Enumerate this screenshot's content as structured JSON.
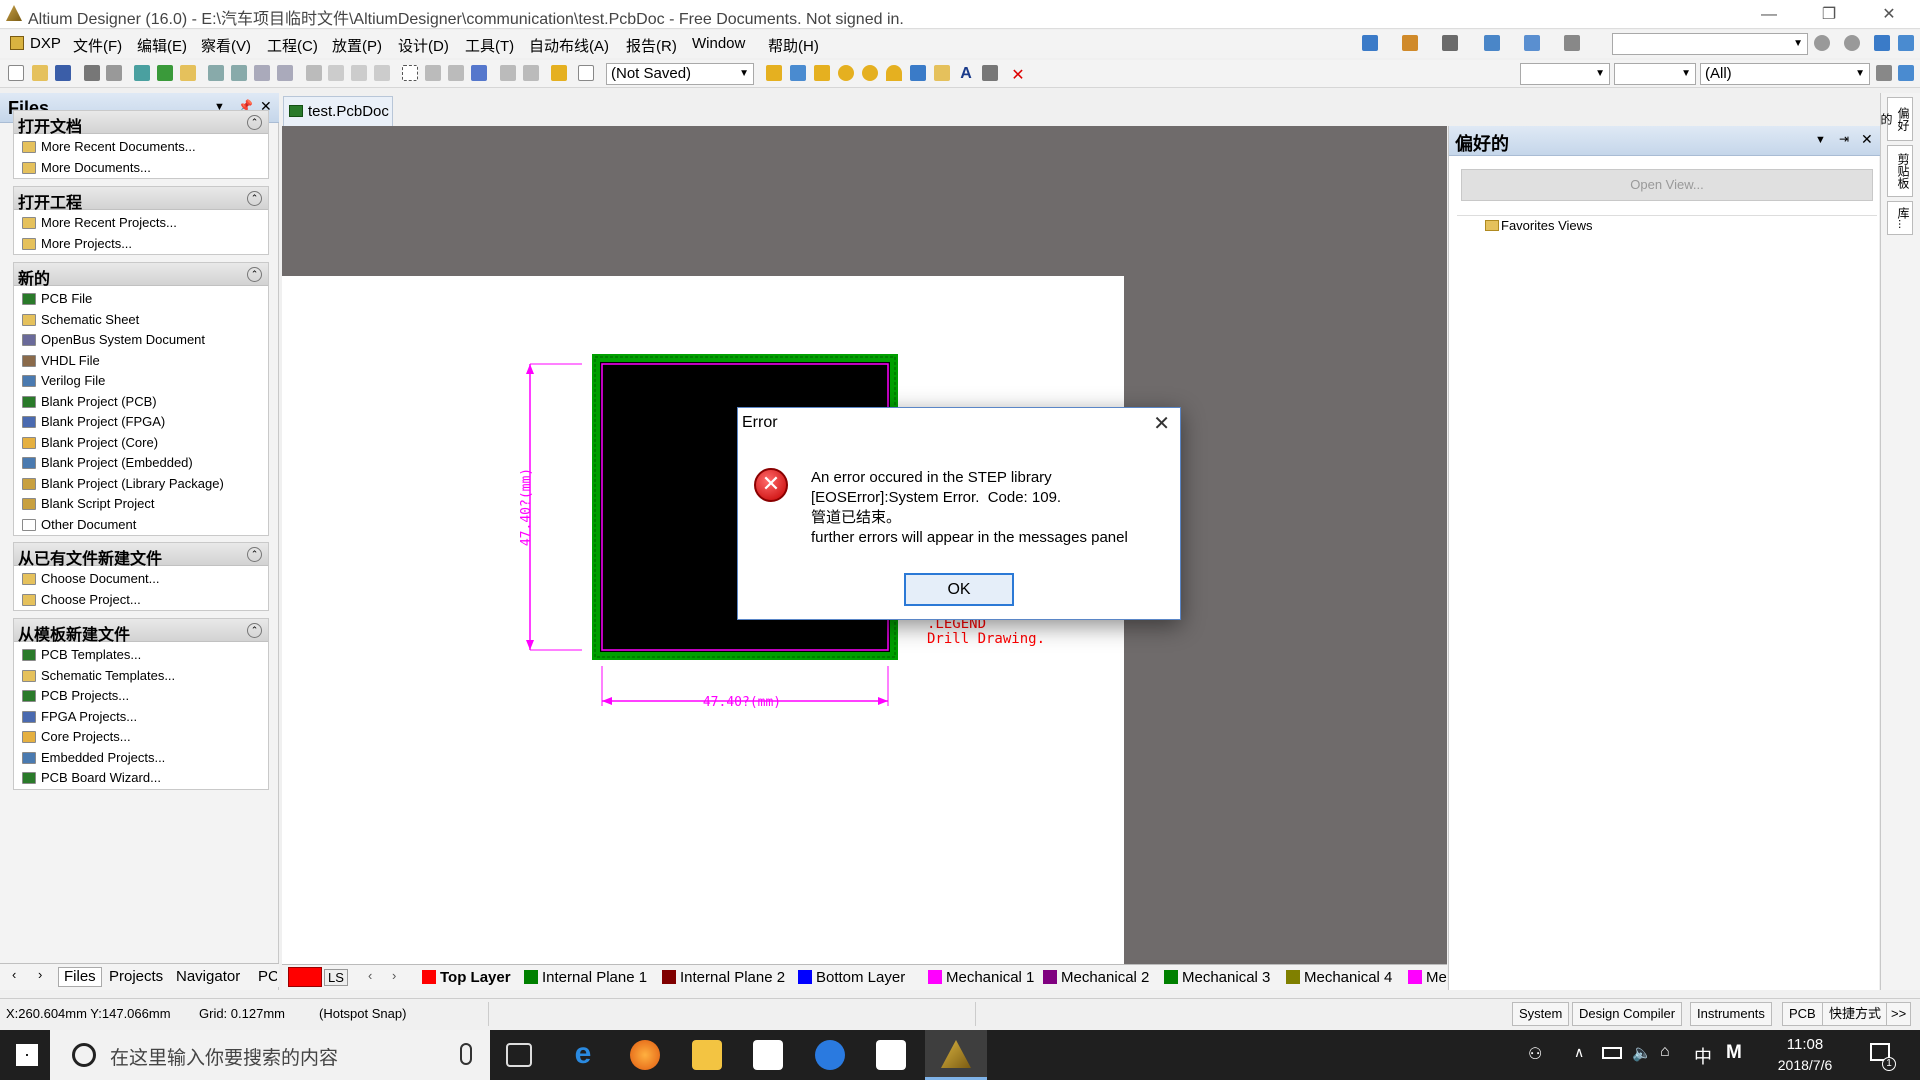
{
  "window": {
    "title": "Altium Designer (16.0) - E:\\汽车项目临时文件\\AltiumDesigner\\communication\\test.PcbDoc - Free Documents. Not signed in."
  },
  "menu": [
    "DXP",
    "文件(F)",
    "编辑(E)",
    "察看(V)",
    "工程(C)",
    "放置(P)",
    "设计(D)",
    "工具(T)",
    "自动布线(A)",
    "报告(R)",
    "Window",
    "帮助(H)"
  ],
  "toolbar": {
    "variant_combo": "(Not Saved)",
    "filter_combo": "(All)"
  },
  "files_panel": {
    "title": "Files",
    "sections": [
      {
        "title": "打开文档",
        "items": [
          {
            "label": "More Recent Documents...",
            "icon": "folder-icon"
          },
          {
            "label": "More Documents...",
            "icon": "open-folder-icon"
          }
        ]
      },
      {
        "title": "打开工程",
        "items": [
          {
            "label": "More Recent Projects...",
            "icon": "folder-icon"
          },
          {
            "label": "More Projects...",
            "icon": "open-folder-icon"
          }
        ]
      },
      {
        "title": "新的",
        "items": [
          {
            "label": "PCB File",
            "icon": "pcb-file-icon"
          },
          {
            "label": "Schematic Sheet",
            "icon": "schematic-icon"
          },
          {
            "label": "OpenBus System Document",
            "icon": "openbus-icon"
          },
          {
            "label": "VHDL File",
            "icon": "vhdl-icon"
          },
          {
            "label": "Verilog File",
            "icon": "verilog-icon"
          },
          {
            "label": "Blank Project (PCB)",
            "icon": "pcb-project-icon"
          },
          {
            "label": "Blank Project (FPGA)",
            "icon": "fpga-project-icon"
          },
          {
            "label": "Blank Project (Core)",
            "icon": "core-project-icon"
          },
          {
            "label": "Blank Project (Embedded)",
            "icon": "embedded-project-icon"
          },
          {
            "label": "Blank Project (Library Package)",
            "icon": "library-project-icon"
          },
          {
            "label": "Blank Script Project",
            "icon": "script-project-icon"
          },
          {
            "label": "Other Document",
            "icon": "document-icon"
          }
        ]
      },
      {
        "title": "从已有文件新建文件",
        "items": [
          {
            "label": "Choose Document...",
            "icon": "open-folder-icon"
          },
          {
            "label": "Choose Project...",
            "icon": "open-folder-icon"
          }
        ]
      },
      {
        "title": "从模板新建文件",
        "items": [
          {
            "label": "PCB Templates...",
            "icon": "pcb-file-icon"
          },
          {
            "label": "Schematic Templates...",
            "icon": "schematic-icon"
          },
          {
            "label": "PCB Projects...",
            "icon": "pcb-project-icon"
          },
          {
            "label": "FPGA Projects...",
            "icon": "fpga-project-icon"
          },
          {
            "label": "Core Projects...",
            "icon": "core-project-icon"
          },
          {
            "label": "Embedded Projects...",
            "icon": "embedded-project-icon"
          },
          {
            "label": "PCB Board Wizard...",
            "icon": "pcb-file-icon"
          }
        ]
      }
    ],
    "tabs": [
      "Files",
      "Projects",
      "Navigator",
      "PCI"
    ]
  },
  "doc_tab": "test.PcbDoc",
  "pcb": {
    "dim_vertical": "47.40?(mm)",
    "dim_horizontal": "47.40?(mm)",
    "legend": ".LEGEND",
    "drill": "Drill Drawing."
  },
  "layers": [
    {
      "name": "LS",
      "color": "#ff0000"
    },
    {
      "name": "Top Layer",
      "color": "#ff0000"
    },
    {
      "name": "Internal Plane 1",
      "color": "#008000"
    },
    {
      "name": "Internal Plane 2",
      "color": "#800000"
    },
    {
      "name": "Bottom Layer",
      "color": "#0000ff"
    },
    {
      "name": "Mechanical 1",
      "color": "#ff00ff"
    },
    {
      "name": "Mechanical 2",
      "color": "#800080"
    },
    {
      "name": "Mechanical 3",
      "color": "#008000"
    },
    {
      "name": "Mechanical 4",
      "color": "#808000"
    },
    {
      "name": "Me",
      "color": "#ff00ff"
    }
  ],
  "right_panel": {
    "title": "偏好的",
    "open_view": "Open View...",
    "favorites": "Favorites Views"
  },
  "side_tabs": [
    "偏好的",
    "剪贴板",
    "库..."
  ],
  "dialog": {
    "title": "Error",
    "message": "An error occured in the STEP library\n[EOSError]:System Error.  Code: 109.\n管道已结束。\nfurther errors will appear in the messages panel",
    "ok": "OK"
  },
  "status": {
    "coords": "X:260.604mm Y:147.066mm",
    "grid": "Grid: 0.127mm",
    "snap": "(Hotspot Snap)",
    "buttons": [
      "System",
      "Design Compiler",
      "Instruments",
      "PCB",
      "快捷方式",
      ">>"
    ]
  },
  "taskbar": {
    "search_placeholder": "在这里输入你要搜索的内容",
    "time": "11:08",
    "date": "2018/7/6",
    "ime": "中",
    "notif_count": "1"
  }
}
